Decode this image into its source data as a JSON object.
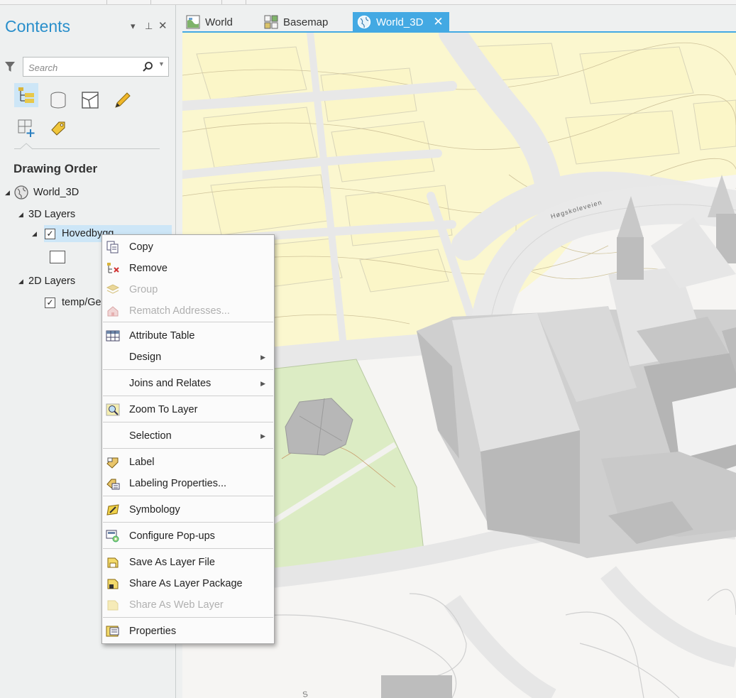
{
  "contents_pane": {
    "title": "Contents",
    "controls": {
      "dropdown": "▾",
      "pin": "⊥",
      "close": "✕"
    },
    "search": {
      "placeholder": "Search"
    },
    "section_title": "Drawing Order",
    "tree": {
      "map_name": "World_3D",
      "group_3d": "3D Layers",
      "layer_3d": "Hovedbygg",
      "group_2d": "2D Layers",
      "layer_2d": "temp/Ge"
    }
  },
  "map_tabs": [
    {
      "label": "World",
      "active": false
    },
    {
      "label": "Basemap",
      "active": false
    },
    {
      "label": "World_3D",
      "active": true
    }
  ],
  "map": {
    "street_label": "Høgskoleveien",
    "corner_label": "S"
  },
  "context_menu": {
    "items": [
      {
        "label": "Copy",
        "icon": "copy-icon",
        "enabled": true,
        "submenu": false
      },
      {
        "label": "Remove",
        "icon": "remove-layer-icon",
        "enabled": true,
        "submenu": false
      },
      {
        "label": "Group",
        "icon": "group-icon",
        "enabled": false,
        "submenu": false
      },
      {
        "label": "Rematch Addresses...",
        "icon": "rematch-icon",
        "enabled": false,
        "submenu": false
      },
      {
        "label": "Attribute Table",
        "icon": "table-icon",
        "enabled": true,
        "submenu": false
      },
      {
        "label": "Design",
        "icon": "",
        "enabled": true,
        "submenu": true
      },
      {
        "label": "Joins and Relates",
        "icon": "",
        "enabled": true,
        "submenu": true
      },
      {
        "label": "Zoom To Layer",
        "icon": "zoom-layer-icon",
        "enabled": true,
        "submenu": false
      },
      {
        "label": "Selection",
        "icon": "",
        "enabled": true,
        "submenu": true
      },
      {
        "label": "Label",
        "icon": "label-icon",
        "enabled": true,
        "submenu": false
      },
      {
        "label": "Labeling Properties...",
        "icon": "labeling-properties-icon",
        "enabled": true,
        "submenu": false
      },
      {
        "label": "Symbology",
        "icon": "symbology-icon",
        "enabled": true,
        "submenu": false
      },
      {
        "label": "Configure Pop-ups",
        "icon": "popup-config-icon",
        "enabled": true,
        "submenu": false
      },
      {
        "label": "Save As Layer File",
        "icon": "save-layer-icon",
        "enabled": true,
        "submenu": false
      },
      {
        "label": "Share As Layer Package",
        "icon": "share-package-icon",
        "enabled": true,
        "submenu": false
      },
      {
        "label": "Share As Web Layer",
        "icon": "share-web-icon",
        "enabled": false,
        "submenu": false
      },
      {
        "label": "Properties",
        "icon": "properties-icon",
        "enabled": true,
        "submenu": false
      }
    ]
  },
  "colors": {
    "accent": "#43a9e3",
    "title_blue": "#2a8fcb",
    "selection": "#cde6f7",
    "parcel_fill": "#fbf7cf",
    "green_area": "#dcecc4",
    "building": "#cfcfcf"
  }
}
